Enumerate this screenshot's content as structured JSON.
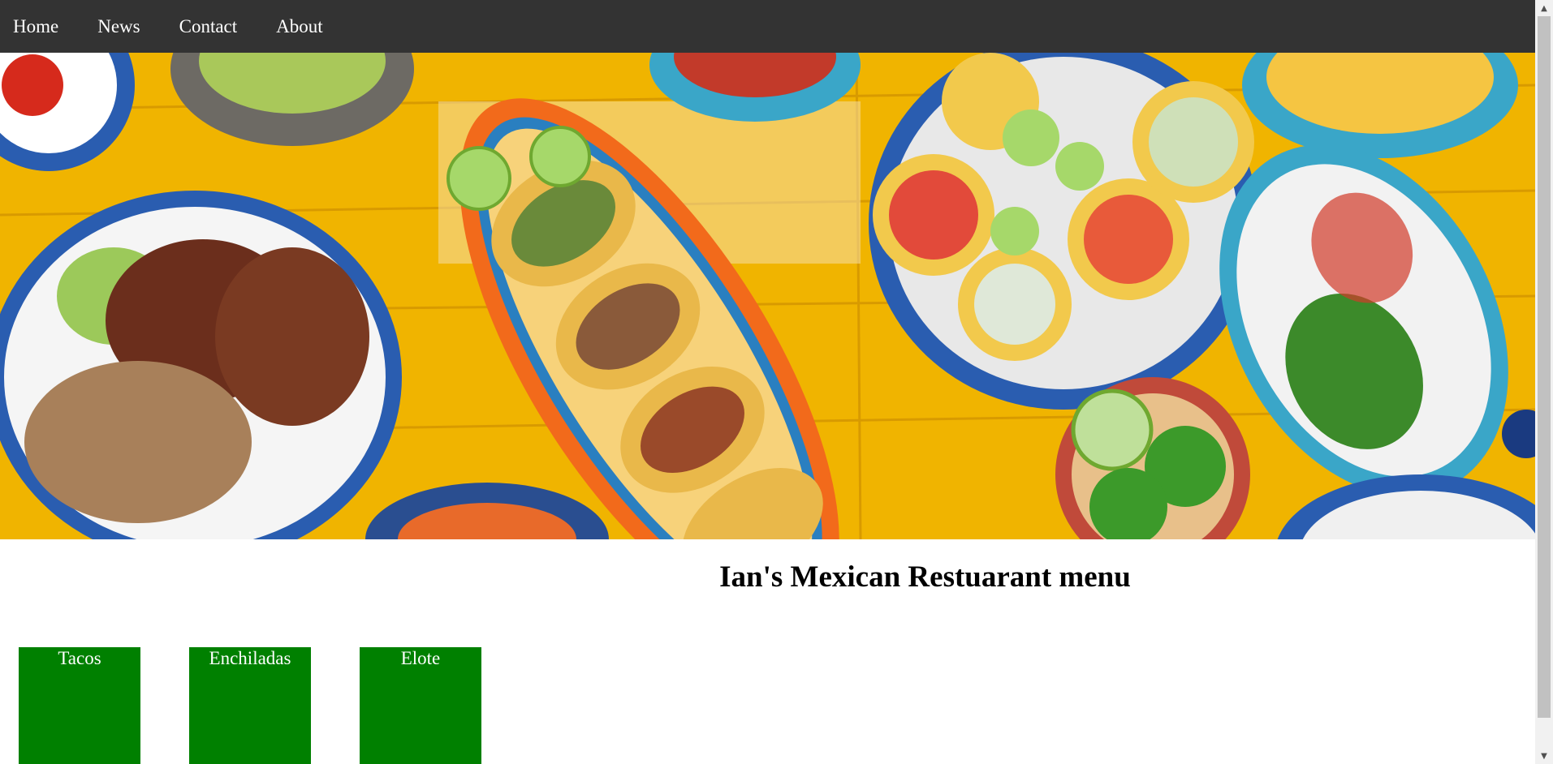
{
  "nav": {
    "items": [
      {
        "label": "Home"
      },
      {
        "label": "News"
      },
      {
        "label": "Contact"
      },
      {
        "label": "About"
      }
    ]
  },
  "hero": {
    "image": "mexican-food-table-image",
    "colors": {
      "wood": "#f2b300",
      "plate_blue": "#2a5db0",
      "tortilla": "#e9b84a",
      "meat": "#7a3a20",
      "lime": "#8cc63f",
      "orange_platter": "#f26a1b"
    }
  },
  "main": {
    "title": "Ian's Mexican Restuarant menu",
    "menu_items": [
      {
        "label": "Tacos"
      },
      {
        "label": "Enchiladas"
      },
      {
        "label": "Elote"
      }
    ],
    "card_color": "#008000"
  },
  "scrollbar": {
    "up_icon": "triangle-up-icon",
    "down_icon": "triangle-down-icon"
  }
}
